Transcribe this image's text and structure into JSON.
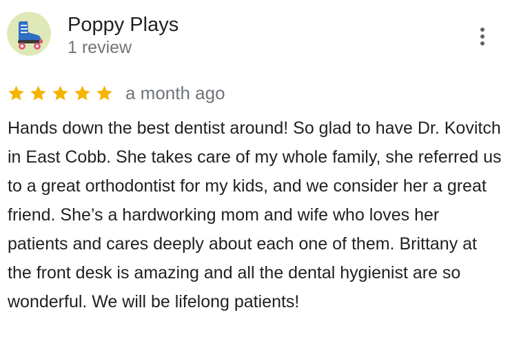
{
  "review": {
    "author": {
      "name": "Poppy Plays",
      "review_count": "1 review",
      "avatar_icon": "roller-skate-avatar-icon"
    },
    "menu_icon": "more-vert-icon",
    "rating": {
      "stars": 5,
      "max_stars": 5,
      "star_color": "#f4b400"
    },
    "date": "a month ago",
    "text": "Hands down the best dentist around! So glad to have Dr. Kovitch in East Cobb. She takes care of my whole family, she referred us to a great orthodontist for my kids, and we consider her a great friend. She’s a hardworking mom and wife who loves her patients and cares deeply about each one of them. Brittany at the front desk is amazing and all the dental hygienist are so wonderful. We will be lifelong patients!"
  },
  "colors": {
    "primary_text": "#202124",
    "secondary_text": "#70757a",
    "star": "#f4b400"
  }
}
